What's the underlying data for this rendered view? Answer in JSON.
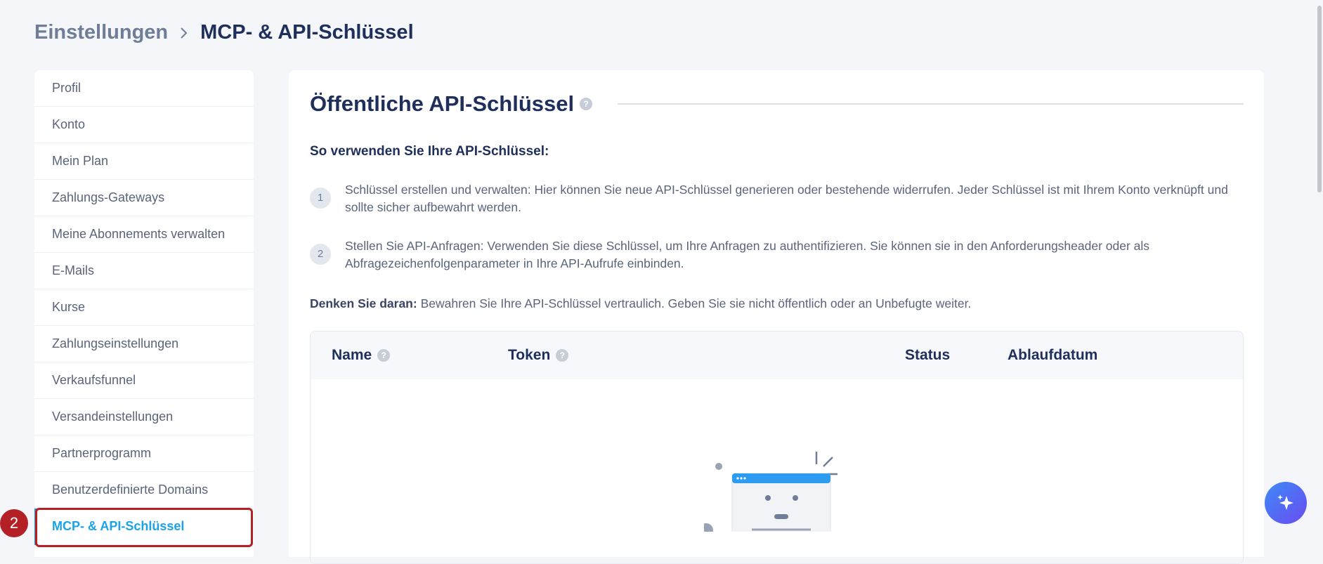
{
  "breadcrumb": {
    "parent": "Einstellungen",
    "current": "MCP- & API-Schlüssel"
  },
  "sidebar": {
    "items": [
      {
        "label": "Profil"
      },
      {
        "label": "Konto"
      },
      {
        "label": "Mein Plan"
      },
      {
        "label": "Zahlungs-Gateways"
      },
      {
        "label": "Meine Abonnements verwalten"
      },
      {
        "label": "E-Mails"
      },
      {
        "label": "Kurse"
      },
      {
        "label": "Zahlungseinstellungen"
      },
      {
        "label": "Verkaufsfunnel"
      },
      {
        "label": "Versandeinstellungen"
      },
      {
        "label": "Partnerprogramm"
      },
      {
        "label": "Benutzerdefinierte Domains"
      },
      {
        "label": "MCP- & API-Schlüssel"
      }
    ],
    "active_index": 12
  },
  "annotation": {
    "step_badge": "2"
  },
  "main": {
    "title": "Öffentliche API-Schlüssel",
    "how_heading": "So verwenden Sie Ihre API-Schlüssel:",
    "steps": [
      {
        "number": "1",
        "text": "Schlüssel erstellen und verwalten: Hier können Sie neue API-Schlüssel generieren oder bestehende widerrufen. Jeder Schlüssel ist mit Ihrem Konto verknüpft und sollte sicher aufbewahrt werden."
      },
      {
        "number": "2",
        "text": "Stellen Sie API-Anfragen: Verwenden Sie diese Schlüssel, um Ihre Anfragen zu authentifizieren. Sie können sie in den Anforderungsheader oder als Abfragezeichenfolgenparameter in Ihre API-Aufrufe einbinden."
      }
    ],
    "remember_label": "Denken Sie daran:",
    "remember_text": " Bewahren Sie Ihre API-Schlüssel vertraulich. Geben Sie sie nicht öffentlich oder an Unbefugte weiter.",
    "table": {
      "columns": [
        "Name",
        "Token",
        "Status",
        "Ablaufdatum"
      ]
    }
  },
  "colors": {
    "accent": "#1aa3e8",
    "annotation_red": "#b32025",
    "title_navy": "#1f2f5c"
  },
  "icons": {
    "breadcrumb_separator": "chevron-right-icon",
    "help": "question-circle-icon",
    "ai_assistant": "sparkles-icon",
    "empty_state": "empty-document-illustration"
  }
}
